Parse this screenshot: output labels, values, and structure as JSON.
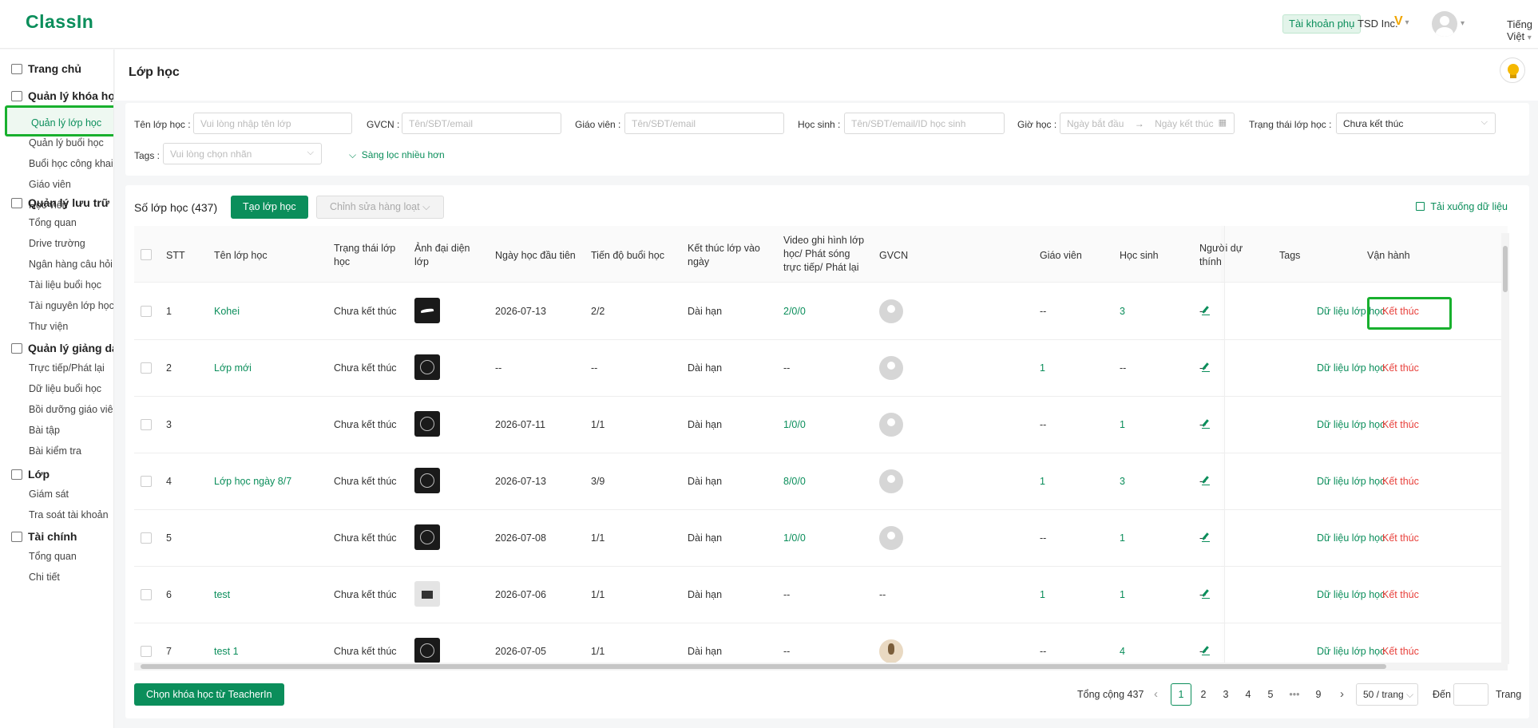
{
  "topbar": {
    "logo": "ClassIn",
    "sub_account": "Tài khoản phụ",
    "org": "TSD Inc.",
    "vip_badge": "V",
    "language": "Tiếng Việt"
  },
  "sidebar": {
    "groups": [
      {
        "label": "Trang chủ",
        "icon": "home-icon",
        "items": []
      },
      {
        "label": "Quản lý khóa học",
        "icon": "course-icon",
        "items": [
          "Quản lý lớp học",
          "Quản lý buổi học",
          "Buổi học công khai",
          "Giáo viên",
          "Học viên"
        ]
      },
      {
        "label": "Quản lý lưu trữ",
        "icon": "cloud-icon",
        "items": [
          "Tổng quan",
          "Drive trường",
          "Ngân hàng câu hỏi",
          "Tài liệu buổi học",
          "Tài nguyên lớp học",
          "Thư viện"
        ]
      },
      {
        "label": "Quản lý giảng dạy",
        "icon": "teaching-icon",
        "items": [
          "Trực tiếp/Phát lại",
          "Dữ liệu buổi học",
          "Bồi dưỡng giáo viên",
          "Bài tập",
          "Bài kiểm tra"
        ]
      },
      {
        "label": "Lớp",
        "icon": "class-icon",
        "items": [
          "Giám sát",
          "Tra soát tài khoản"
        ]
      },
      {
        "label": "Tài chính",
        "icon": "finance-icon",
        "items": [
          "Tổng quan",
          "Chi tiết"
        ]
      }
    ],
    "active_item": "Quản lý lớp học"
  },
  "page": {
    "title": "Lớp học"
  },
  "filters": {
    "class_name": {
      "label": "Tên lớp học :",
      "placeholder": "Vui lòng nhập tên lớp"
    },
    "gvcn": {
      "label": "GVCN :",
      "placeholder": "Tên/SĐT/email"
    },
    "teacher": {
      "label": "Giáo viên :",
      "placeholder": "Tên/SĐT/email"
    },
    "student": {
      "label": "Học sinh :",
      "placeholder": "Tên/SĐT/email/ID học sinh"
    },
    "time": {
      "label": "Giờ học :",
      "start_placeholder": "Ngày bắt đầu",
      "arrow": "→",
      "end_placeholder": "Ngày kết thúc"
    },
    "status": {
      "label": "Trạng thái lớp học :",
      "value": "Chưa kết thúc"
    },
    "tags": {
      "label": "Tags :",
      "placeholder": "Vui lòng chọn nhãn"
    },
    "more": "Sàng lọc nhiều hơn"
  },
  "toolbar": {
    "count_label": "Số lớp học (437)",
    "create_button": "Tạo lớp học",
    "bulk_edit_button": "Chỉnh sửa hàng loạt",
    "download": "Tải xuống dữ liệu"
  },
  "table": {
    "headers": {
      "stt": "STT",
      "name": "Tên lớp học",
      "status": [
        "Trạng thái lớp",
        "học"
      ],
      "avatar": [
        "Ảnh đại diện",
        "lớp"
      ],
      "first_date": "Ngày học đầu tiên",
      "progress": "Tiến độ buổi học",
      "end_by_date": [
        "Kết thúc lớp vào",
        "ngày"
      ],
      "video": [
        "Video ghi hình lớp",
        "học/ Phát sóng",
        "trực tiếp/ Phát lại"
      ],
      "gvcn": "GVCN",
      "teachers": "Giáo viên",
      "students": "Học sinh",
      "auditors": [
        "Người dự",
        "thính"
      ],
      "tags": "Tags",
      "ops": "Vận hành"
    },
    "rows": [
      {
        "stt": "1",
        "name": "Kohei",
        "status": "Chưa kết thúc",
        "thumb": "bird",
        "first_date": "2026-07-13",
        "progress": "2/2",
        "end": "Dài hạn",
        "video": "2/0/0",
        "gvcn": "avatar",
        "teachers": "--",
        "students": "3",
        "auditors": "--",
        "op_data": "Dữ liệu lớp học",
        "op_end": "Kết thúc"
      },
      {
        "stt": "2",
        "name": "Lớp mới",
        "status": "Chưa kết thúc",
        "thumb": "cam",
        "first_date": "--",
        "progress": "--",
        "end": "Dài hạn",
        "video": "--",
        "gvcn": "avatar",
        "teachers": "1",
        "students": "--",
        "auditors": "--",
        "op_data": "Dữ liệu lớp học",
        "op_end": "Kết thúc"
      },
      {
        "stt": "3",
        "name": "",
        "status": "Chưa kết thúc",
        "thumb": "cam",
        "first_date": "2026-07-11",
        "progress": "1/1",
        "end": "Dài hạn",
        "video": "1/0/0",
        "gvcn": "avatar",
        "teachers": "--",
        "students": "1",
        "auditors": "--",
        "op_data": "Dữ liệu lớp học",
        "op_end": "Kết thúc"
      },
      {
        "stt": "4",
        "name": "Lớp học ngày 8/7",
        "status": "Chưa kết thúc",
        "thumb": "cam",
        "first_date": "2026-07-13",
        "progress": "3/9",
        "end": "Dài hạn",
        "video": "8/0/0",
        "gvcn": "avatar",
        "teachers": "1",
        "students": "3",
        "auditors": "--",
        "op_data": "Dữ liệu lớp học",
        "op_end": "Kết thúc"
      },
      {
        "stt": "5",
        "name": "",
        "status": "Chưa kết thúc",
        "thumb": "cam",
        "first_date": "2026-07-08",
        "progress": "1/1",
        "end": "Dài hạn",
        "video": "1/0/0",
        "gvcn": "avatar",
        "teachers": "--",
        "students": "1",
        "auditors": "--",
        "op_data": "Dữ liệu lớp học",
        "op_end": "Kết thúc"
      },
      {
        "stt": "6",
        "name": "test",
        "status": "Chưa kết thúc",
        "thumb": "grey",
        "first_date": "2026-07-06",
        "progress": "1/1",
        "end": "Dài hạn",
        "video": "--",
        "gvcn": "--",
        "teachers": "1",
        "students": "1",
        "auditors": "--",
        "op_data": "Dữ liệu lớp học",
        "op_end": "Kết thúc"
      },
      {
        "stt": "7",
        "name": "test 1",
        "status": "Chưa kết thúc",
        "thumb": "cam",
        "first_date": "2026-07-05",
        "progress": "1/1",
        "end": "Dài hạn",
        "video": "--",
        "gvcn": "photo",
        "teachers": "--",
        "students": "4",
        "auditors": "--",
        "op_data": "Dữ liệu lớp học",
        "op_end": "Kết thúc"
      }
    ]
  },
  "footer": {
    "teacherin_button": "Chọn khóa học từ TeacherIn",
    "total": "Tổng cộng 437",
    "prev": "‹",
    "pages": [
      "1",
      "2",
      "3",
      "4",
      "5",
      "•••",
      "9"
    ],
    "current_page": "1",
    "next": "›",
    "page_size": "50 / trang",
    "jump_label": "Đến",
    "jump_suffix": "Trang"
  },
  "colors": {
    "accent": "#0b8e5b",
    "danger": "#e8413c",
    "highlight": "#18b02e"
  }
}
